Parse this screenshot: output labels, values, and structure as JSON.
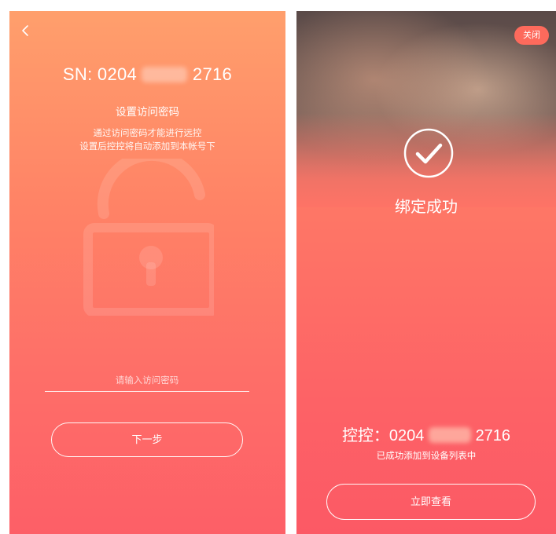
{
  "left_screen": {
    "sn_prefix": "SN: 0204",
    "sn_suffix": "2716",
    "title": "设置访问密码",
    "desc_line1": "通过访问密码才能进行远控",
    "desc_line2": "设置后控控将自动添加到本帐号下",
    "password_placeholder": "请输入访问密码",
    "next_label": "下一步",
    "icons": [
      "back-arrow-icon",
      "unlocked-padlock-icon"
    ]
  },
  "right_screen": {
    "close_label": "关闭",
    "bind_success": "绑定成功",
    "device_prefix": "控控：0204",
    "device_suffix": "2716",
    "added_message": "已成功添加到设备列表中",
    "view_label": "立即查看",
    "icons": [
      "check-circle-icon"
    ]
  },
  "colors": {
    "left_gradient_top": "#ff9f6c",
    "left_gradient_bottom": "#fd5f67",
    "right_gradient_top": "#ff8a67",
    "right_gradient_bottom": "#fc5965",
    "close_button_bg": "#fd6a5c",
    "text": "#ffffff"
  }
}
